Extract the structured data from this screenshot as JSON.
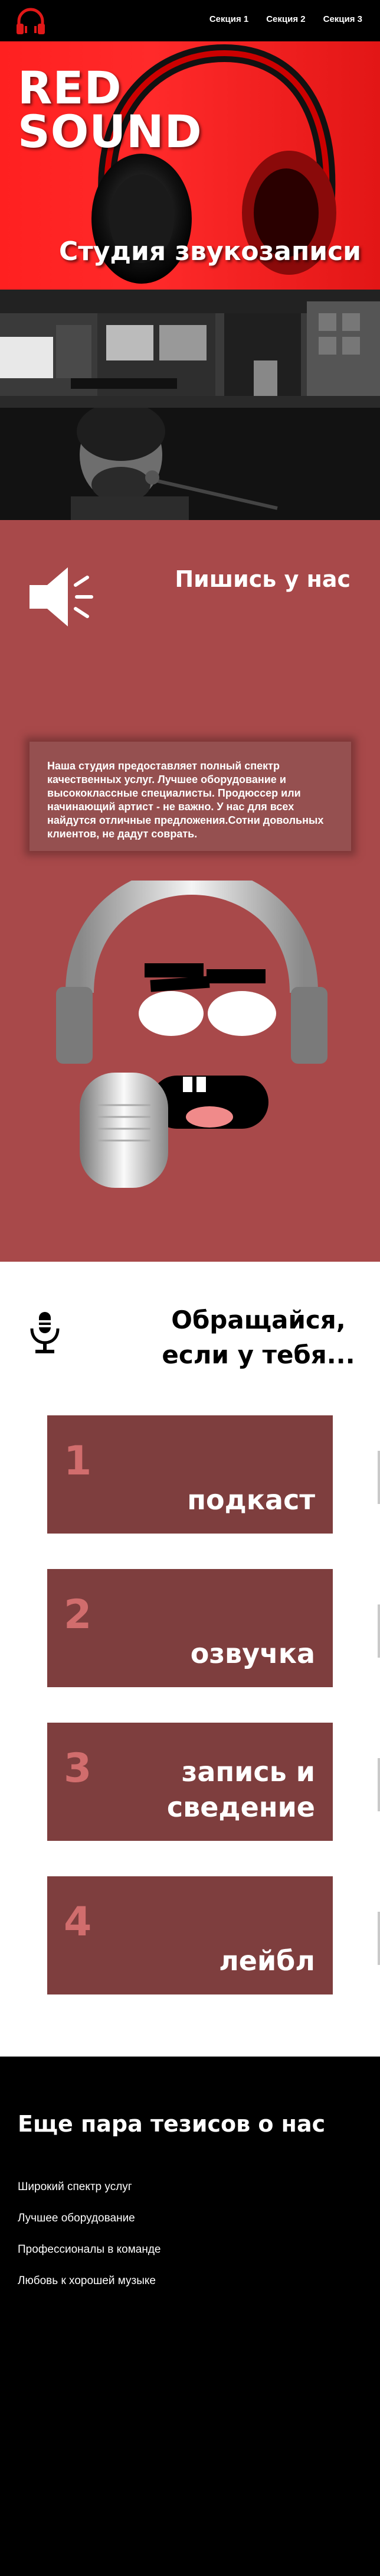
{
  "nav": {
    "links": [
      "Секция 1",
      "Секция 2",
      "Секция 3"
    ]
  },
  "hero": {
    "brand_line1": "RED",
    "brand_line2": "SOUND",
    "tagline": "Студия звукозаписи"
  },
  "about": {
    "title": "Пишись у нас",
    "text": "Наша студия предоставляет полный спектр качественных услуг. Лучшее оборудование и высококлассные специалисты. Продюссер или начинающий артист - не важно. У нас для всех найдутся отличные предложения.Сотни довольных клиентов, не дадут соврать."
  },
  "services": {
    "title_line1": "Обращайся,",
    "title_line2": "если у тебя...",
    "items": [
      {
        "num": "1",
        "label": "подкаст"
      },
      {
        "num": "2",
        "label": "озвучка"
      },
      {
        "num": "3",
        "label": "запись и сведение"
      },
      {
        "num": "4",
        "label": "лейбл"
      }
    ]
  },
  "theses": {
    "title": "Еще пара тезисов о нас",
    "items": [
      "Широкий спектр услуг",
      "Лучшее оборудование",
      "Профессионалы в команде",
      "Любовь к хорошей музыке"
    ]
  },
  "colors": {
    "hero_red": "#ff2020",
    "section_red": "#a8494a",
    "service_card": "#7e3e3e",
    "service_number": "#d16d6d"
  }
}
